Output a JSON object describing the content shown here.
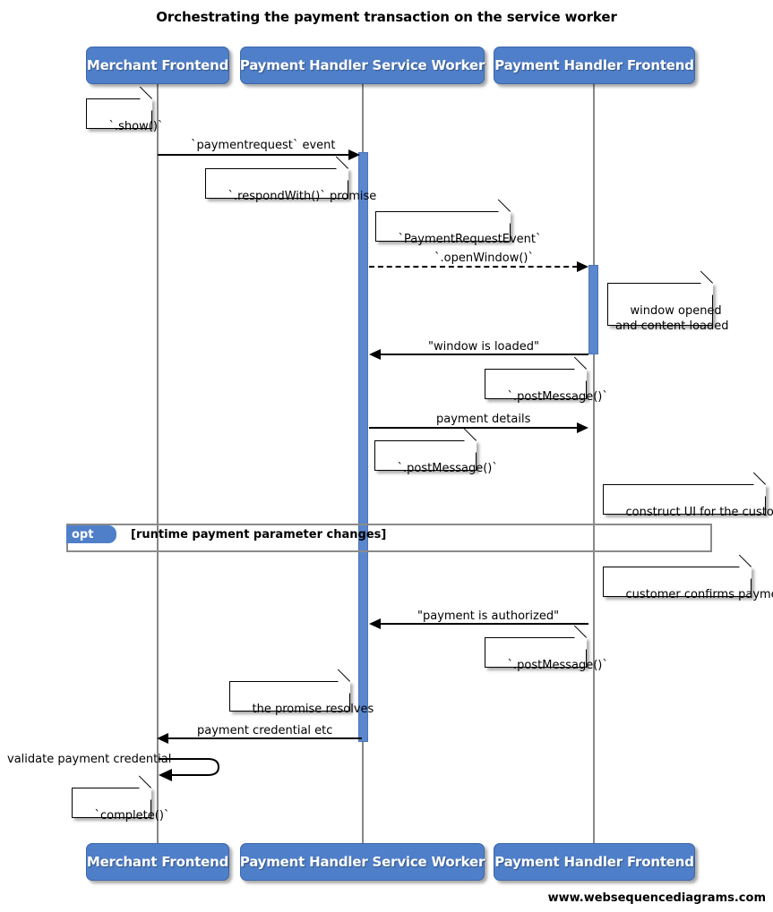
{
  "diagram": {
    "title": "Orchestrating the payment transaction on the service worker",
    "footer_credit": "www.websequencediagrams.com",
    "colors": {
      "participant_fill": "#4f7fc9",
      "activation_fill": "#5b87cf",
      "lifeline": "#888888",
      "fragment_border": "#8a8a8a",
      "note_fill": "#ffffff",
      "line": "#000000"
    }
  },
  "participants": [
    {
      "id": "merchant",
      "label": "Merchant Frontend"
    },
    {
      "id": "sw",
      "label": "Payment Handler Service Worker"
    },
    {
      "id": "phf",
      "label": "Payment Handler Frontend"
    }
  ],
  "participants_bottom": [
    {
      "id": "merchant",
      "label": "Merchant Frontend"
    },
    {
      "id": "sw",
      "label": "Payment Handler Service Worker"
    },
    {
      "id": "phf",
      "label": "Payment Handler Frontend"
    }
  ],
  "messages": [
    {
      "id": "m1",
      "label": "`paymentrequest` event",
      "from": "merchant",
      "to": "sw",
      "style": "solid",
      "direction": "right"
    },
    {
      "id": "m2",
      "label": "`.openWindow()`",
      "from": "sw",
      "to": "phf",
      "style": "dashed",
      "direction": "right"
    },
    {
      "id": "m3",
      "label": "\"window is loaded\"",
      "from": "phf",
      "to": "sw",
      "style": "solid",
      "direction": "left"
    },
    {
      "id": "m4",
      "label": "payment details",
      "from": "sw",
      "to": "phf",
      "style": "solid",
      "direction": "right"
    },
    {
      "id": "m5",
      "label": "\"payment is authorized\"",
      "from": "phf",
      "to": "sw",
      "style": "solid",
      "direction": "left"
    },
    {
      "id": "m6",
      "label": "payment credential etc",
      "from": "sw",
      "to": "merchant",
      "style": "solid",
      "direction": "left"
    },
    {
      "id": "m7",
      "label": "validate payment credential",
      "from": "merchant",
      "to": "merchant",
      "style": "self",
      "direction": "left"
    }
  ],
  "notes": [
    {
      "id": "n1",
      "text": "`.show()`"
    },
    {
      "id": "n2",
      "text": "`.respondWith()` promise"
    },
    {
      "id": "n3",
      "text": "`PaymentRequestEvent`"
    },
    {
      "id": "n4",
      "text": "window opened\nand content loaded"
    },
    {
      "id": "n5",
      "text": "`.postMessage()`"
    },
    {
      "id": "n6",
      "text": "`.postMessage()`"
    },
    {
      "id": "n7",
      "text": "construct UI for the customer"
    },
    {
      "id": "n8",
      "text": "customer confirms payment"
    },
    {
      "id": "n9",
      "text": "`.postMessage()`"
    },
    {
      "id": "n10",
      "text": "the promise resolves"
    },
    {
      "id": "n11",
      "text": "`complete()`"
    }
  ],
  "fragments": [
    {
      "id": "opt1",
      "type": "opt",
      "condition": "[runtime payment parameter changes]"
    }
  ]
}
